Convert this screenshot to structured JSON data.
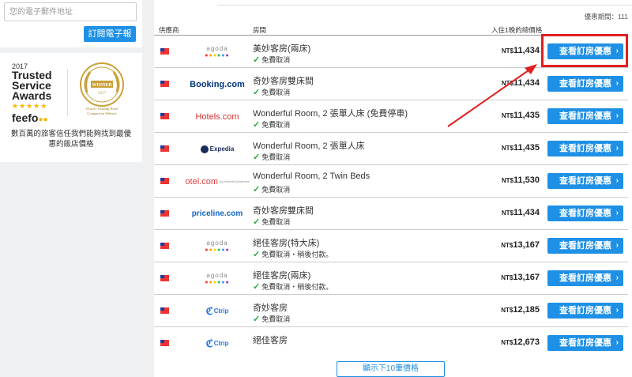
{
  "subscribe": {
    "placeholder": "您的電子郵件地址",
    "button": "訂閱電子報"
  },
  "award": {
    "year": "2017",
    "title_lines": [
      "Trusted",
      "Service",
      "Awards"
    ],
    "stars": "★★★★★",
    "feefo": "feefo",
    "caption": "數百萬的旅客信任我們能夠找到最優惠的飯店價格"
  },
  "expiry": "優惠期間：111",
  "columns": {
    "provider": "供應商",
    "room": "房間",
    "price": "入住1晚的總價格"
  },
  "button_label": "查看訂房優惠",
  "currency": "NT$",
  "offers": [
    {
      "provider": "agoda",
      "room": "美妙客房(兩床)",
      "cancel": "免費取消",
      "price": "11,434"
    },
    {
      "provider": "Booking.com",
      "room": "奇妙客房雙床間",
      "cancel": "免費取消",
      "price": "11,434"
    },
    {
      "provider": "Hotels.com",
      "room": "Wonderful Room, 2 張單人床 (免費停車)",
      "cancel": "免費取消",
      "price": "11,435"
    },
    {
      "provider": "Expedia",
      "room": "Wonderful Room, 2 張單人床",
      "cancel": "免費取消",
      "price": "11,435"
    },
    {
      "provider": "otel.com",
      "room": "Wonderful Room, 2 Twin Beds",
      "cancel": "免費取消",
      "price": "11,530"
    },
    {
      "provider": "priceline.com",
      "room": "奇妙客房雙床間",
      "cancel": "免費取消",
      "price": "11,434"
    },
    {
      "provider": "agoda",
      "room": "絕佳客房(特大床)",
      "cancel": "免費取消・稍後付款。",
      "price": "13,167"
    },
    {
      "provider": "agoda",
      "room": "絕佳客房(兩床)",
      "cancel": "免費取消・稍後付款。",
      "price": "13,167"
    },
    {
      "provider": "Ctrip",
      "room": "奇妙客房",
      "cancel": "免費取消",
      "price": "12,185"
    },
    {
      "provider": "Ctrip",
      "room": "絕佳客房",
      "cancel": "",
      "price": "12,673"
    }
  ],
  "more_button": "顯示下10筆價格",
  "colors": {
    "accent": "#1e90e6",
    "highlight": "#e02020",
    "check": "#2aa84a"
  }
}
